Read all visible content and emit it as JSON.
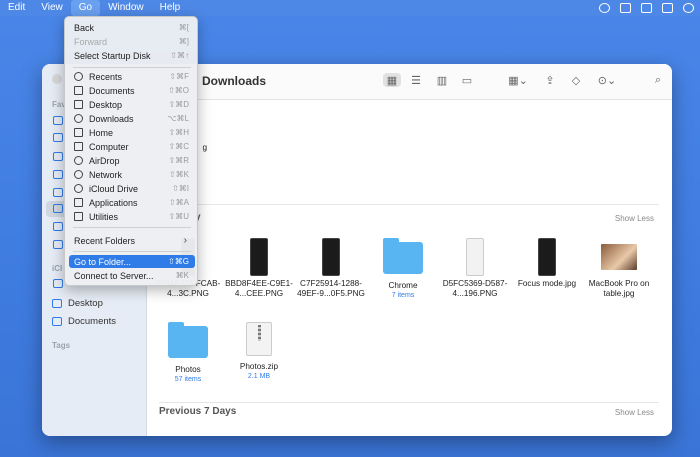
{
  "menubar": {
    "items": [
      "Edit",
      "View",
      "Go",
      "Window",
      "Help"
    ]
  },
  "go_menu": {
    "back": {
      "label": "Back",
      "shortcut": "⌘["
    },
    "forward": {
      "label": "Forward",
      "shortcut": "⌘]"
    },
    "startup": {
      "label": "Select Startup Disk",
      "shortcut": "⇧⌘↑"
    },
    "places": [
      {
        "label": "Recents",
        "shortcut": "⇧⌘F",
        "icon": "clock-icon"
      },
      {
        "label": "Documents",
        "shortcut": "⇧⌘O",
        "icon": "document-icon"
      },
      {
        "label": "Desktop",
        "shortcut": "⇧⌘D",
        "icon": "desktop-icon"
      },
      {
        "label": "Downloads",
        "shortcut": "⌥⌘L",
        "icon": "download-icon"
      },
      {
        "label": "Home",
        "shortcut": "⇧⌘H",
        "icon": "home-icon"
      },
      {
        "label": "Computer",
        "shortcut": "⇧⌘C",
        "icon": "laptop-icon"
      },
      {
        "label": "AirDrop",
        "shortcut": "⇧⌘R",
        "icon": "airdrop-icon"
      },
      {
        "label": "Network",
        "shortcut": "⇧⌘K",
        "icon": "globe-icon"
      },
      {
        "label": "iCloud Drive",
        "shortcut": "⇧⌘I",
        "icon": "cloud-icon"
      },
      {
        "label": "Applications",
        "shortcut": "⇧⌘A",
        "icon": "applications-icon"
      },
      {
        "label": "Utilities",
        "shortcut": "⇧⌘U",
        "icon": "utilities-icon"
      }
    ],
    "recent_folders": "Recent Folders",
    "go_to_folder": {
      "label": "Go to Folder...",
      "shortcut": "⇧⌘G"
    },
    "connect": {
      "label": "Connect to Server...",
      "shortcut": "⌘K"
    }
  },
  "window": {
    "title": "Downloads",
    "sidebar": {
      "section_top": "Fav",
      "section_icloud": "iCl",
      "items": [
        {
          "label": "Desktop",
          "icon": "desktop-icon"
        },
        {
          "label": "Documents",
          "icon": "document-icon"
        }
      ],
      "tags_label": "Tags"
    },
    "sections": [
      {
        "title": "y",
        "show_less": "Show Less"
      },
      {
        "title": "Previous 7 Days",
        "show_less": "Show Less"
      }
    ],
    "partial_file_label": "g",
    "files_row1": [
      {
        "name": "9884A373-FCAB-4...3C.PNG",
        "sub": ""
      },
      {
        "name": "BBD8F4EE-C9E1-4...CEE.PNG",
        "sub": ""
      },
      {
        "name": "C7F25914-1288-49EF-9...0F5.PNG",
        "sub": ""
      },
      {
        "name": "Chrome",
        "sub": "7 items"
      },
      {
        "name": "D5FC5369-D587-4...196.PNG",
        "sub": ""
      },
      {
        "name": "Focus mode.jpg",
        "sub": ""
      },
      {
        "name": "MacBook Pro on table.jpg",
        "sub": ""
      }
    ],
    "files_row2": [
      {
        "name": "Photos",
        "sub": "57 items"
      },
      {
        "name": "Photos.zip",
        "sub": "2.1 MB"
      }
    ]
  },
  "colors": {
    "desktop": "#3f7ce0",
    "accent": "#2f7be8",
    "folder": "#59b4f2"
  }
}
